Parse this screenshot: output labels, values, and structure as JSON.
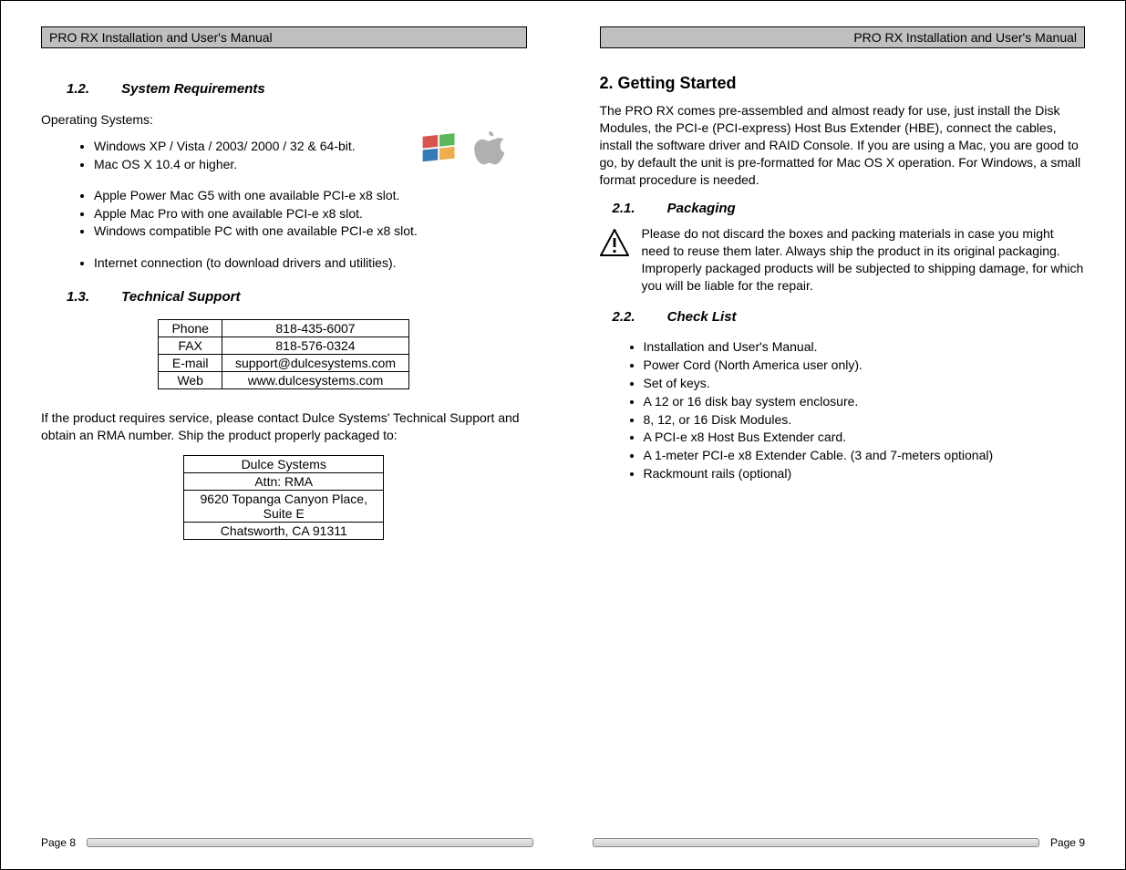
{
  "header_left": "PRO RX Installation and User's Manual",
  "header_right": "PRO RX Installation and User's Manual",
  "left": {
    "sec12_num": "1.2.",
    "sec12_title": "System Requirements",
    "os_label": "Operating Systems:",
    "os_list": [
      "Windows XP / Vista / 2003/ 2000 /  32 & 64-bit.",
      "Mac OS X 10.4 or higher."
    ],
    "hw_list": [
      "Apple Power Mac G5 with one available PCI-e x8 slot.",
      "Apple Mac Pro with one available PCI-e x8 slot.",
      "Windows compatible PC with one available PCI-e x8 slot."
    ],
    "net_list": [
      "Internet connection (to download drivers and utilities)."
    ],
    "sec13_num": "1.3.",
    "sec13_title": "Technical Support",
    "contacts": [
      [
        "Phone",
        "818-435-6007"
      ],
      [
        "FAX",
        "818-576-0324"
      ],
      [
        "E-mail",
        "support@dulcesystems.com"
      ],
      [
        "Web",
        "www.dulcesystems.com"
      ]
    ],
    "rma_text": "If the product requires service, please contact Dulce Systems' Technical Support and obtain an RMA number.  Ship the product properly packaged to:",
    "address": [
      "Dulce Systems",
      "Attn: RMA",
      "9620 Topanga Canyon Place, Suite E",
      "Chatsworth, CA  91311"
    ]
  },
  "right": {
    "chapter": "2. Getting Started",
    "intro": "The PRO RX comes pre-assembled and almost ready for use, just install the Disk Modules, the PCI-e (PCI-express) Host Bus Extender (HBE), connect the cables, install the software driver and RAID Console.   If you are using a Mac, you are good to go, by default the unit is pre-formatted for Mac OS X operation.   For Windows, a small format procedure is needed.",
    "sec21_num": "2.1.",
    "sec21_title": "Packaging",
    "packaging_text": "Please do not discard the boxes and packing materials in case you might need to reuse them later.  Always ship the product in its original packaging.  Improperly packaged products will be subjected to shipping damage, for which you will be liable for the repair.",
    "sec22_num": "2.2.",
    "sec22_title": "Check List",
    "checklist": [
      "Installation and User's Manual.",
      "Power Cord (North America user only).",
      "Set of keys.",
      "A 12 or 16 disk bay system enclosure.",
      "8, 12, or 16 Disk Modules.",
      "A PCI-e x8 Host Bus Extender card.",
      "A 1-meter PCI-e x8 Extender Cable.  (3 and 7-meters optional)",
      "Rackmount rails (optional)"
    ]
  },
  "footer_left": "Page 8",
  "footer_right": "Page 9"
}
